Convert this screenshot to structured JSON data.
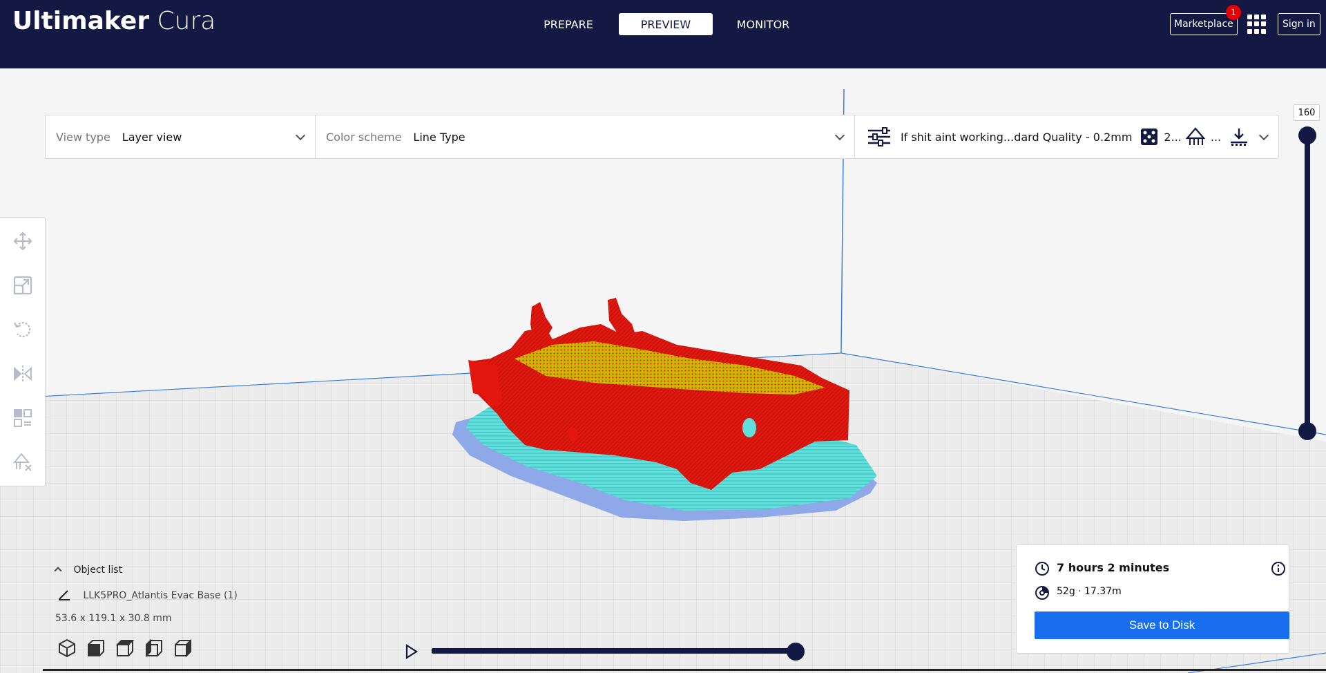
{
  "app": {
    "logo_bold": "Ultimaker",
    "logo_light": " Cura"
  },
  "stages": [
    {
      "label": "PREPARE",
      "active": false
    },
    {
      "label": "PREVIEW",
      "active": true
    },
    {
      "label": "MONITOR",
      "active": false
    }
  ],
  "header": {
    "marketplace_label": "Marketplace",
    "marketplace_badge": "1",
    "signin_label": "Sign in"
  },
  "toolbar": {
    "view_type_label": "View type",
    "view_type_value": "Layer view",
    "color_scheme_label": "Color scheme",
    "color_scheme_value": "Line Type",
    "print_profile": "If shit aint working...dard Quality - 0.2mm",
    "infill_value": "2...",
    "support_value": "..."
  },
  "layer_slider": {
    "value": "160"
  },
  "object_list": {
    "header": "Object list",
    "object_name": "LLK5PRO_Atlantis Evac Base (1)",
    "dimensions": "53.6 x 119.1 x 30.8 mm"
  },
  "print_summary": {
    "time": "7 hours 2 minutes",
    "material": "52g · 17.37m",
    "save_label": "Save to Disk"
  },
  "colors": {
    "header_bg": "#141944",
    "accent_blue": "#196ef0",
    "wall_red": "#e3170e",
    "support_cyan": "#5fe0dc",
    "skirt_blue": "#8fa8e8",
    "infill_yellow": "#c8c800"
  },
  "icons": {
    "move": "move-icon",
    "scale": "scale-icon",
    "rotate": "rotate-icon",
    "mirror": "mirror-icon",
    "per_model": "per-model-settings-icon",
    "support_blocker": "support-blocker-icon"
  }
}
